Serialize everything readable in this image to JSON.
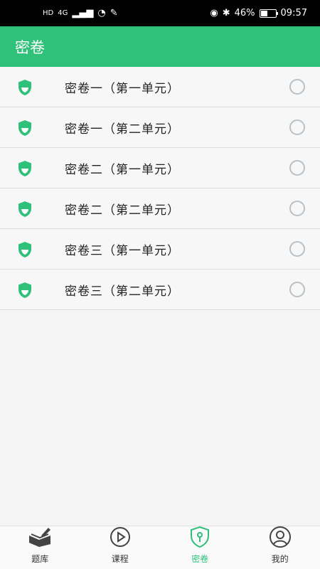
{
  "status_bar": {
    "left_icons": [
      "hd-icon",
      "4g-signal-icon",
      "wifi-icon",
      "notification-icon"
    ],
    "signal_text": "4G",
    "battery_percent": "46%",
    "battery_level": 0.46,
    "time": "09:57"
  },
  "appbar": {
    "title": "密卷"
  },
  "papers": [
    {
      "label": "密卷一（第一单元）"
    },
    {
      "label": "密卷一（第二单元）"
    },
    {
      "label": "密卷二（第一单元）"
    },
    {
      "label": "密卷二（第二单元）"
    },
    {
      "label": "密卷三（第一单元）"
    },
    {
      "label": "密卷三（第二单元）"
    }
  ],
  "tabs": [
    {
      "label": "题库",
      "icon": "books-icon",
      "active": false
    },
    {
      "label": "课程",
      "icon": "play-icon",
      "active": false
    },
    {
      "label": "密卷",
      "icon": "shield-lock-icon",
      "active": true
    },
    {
      "label": "我的",
      "icon": "profile-icon",
      "active": false
    }
  ],
  "colors": {
    "accent": "#2fc07a",
    "radio_border": "#b8c1c7"
  }
}
